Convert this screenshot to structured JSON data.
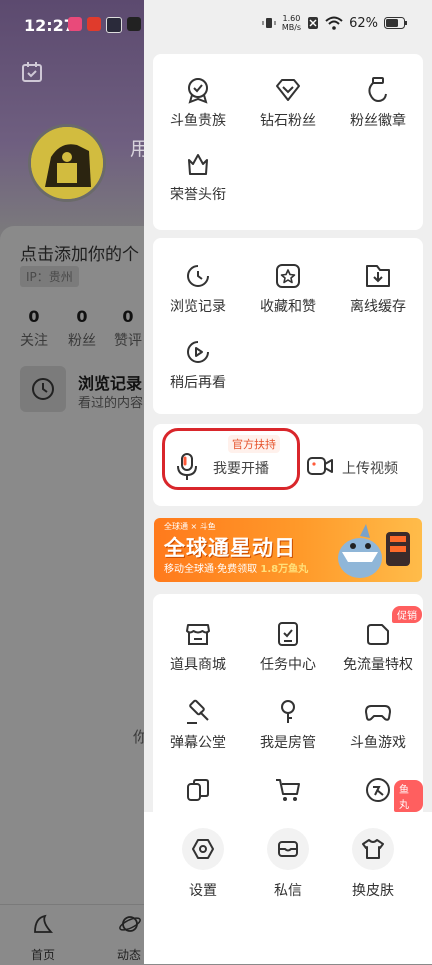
{
  "status_bar": {
    "time": "12:27",
    "net_speed_value": "1.60",
    "net_speed_unit": "MB/s",
    "battery": "62%"
  },
  "background": {
    "username": "用",
    "bio": "点击添加你的个",
    "ip": "IP：贵州",
    "stats": [
      {
        "value": "0",
        "label": "关注"
      },
      {
        "value": "0",
        "label": "粉丝"
      },
      {
        "value": "0",
        "label": "赞评"
      }
    ],
    "history_title": "浏览记录",
    "history_sub": "看过的内容",
    "mid_text": "你",
    "tabs": [
      {
        "label": "首页"
      },
      {
        "label": "动态"
      }
    ]
  },
  "drawer": {
    "card1": [
      {
        "label": "斗鱼贵族",
        "icon": "noble-medal-icon"
      },
      {
        "label": "钻石粉丝",
        "icon": "diamond-icon"
      },
      {
        "label": "粉丝徽章",
        "icon": "fan-badge-icon"
      },
      {
        "label": "荣誉头衔",
        "icon": "crown-icon"
      }
    ],
    "card2": [
      {
        "label": "浏览记录",
        "icon": "history-clock-icon"
      },
      {
        "label": "收藏和赞",
        "icon": "favorite-star-icon"
      },
      {
        "label": "离线缓存",
        "icon": "download-icon"
      },
      {
        "label": "稍后再看",
        "icon": "watch-later-icon"
      }
    ],
    "live": {
      "official_badge": "官方扶持",
      "start_label": "我要开播",
      "upload_label": "上传视频"
    },
    "banner": {
      "top": "全球通 × 斗鱼",
      "title": "全球通星动日",
      "sub_prefix": "移动全球通·免费领取",
      "sub_highlight": "1.8万鱼丸"
    },
    "card3": [
      {
        "label": "道具商城",
        "icon": "shop-icon"
      },
      {
        "label": "任务中心",
        "icon": "task-icon"
      },
      {
        "label": "免流量特权",
        "icon": "free-data-icon",
        "badge": "促销"
      },
      {
        "label": "弹幕公堂",
        "icon": "gavel-icon"
      },
      {
        "label": "我是房管",
        "icon": "key-icon"
      },
      {
        "label": "斗鱼游戏",
        "icon": "gamepad-icon"
      },
      {
        "label": "",
        "icon": "copy-icon"
      },
      {
        "label": "",
        "icon": "cart-icon"
      },
      {
        "label": "",
        "icon": "yuwan-icon",
        "badge": "鱼丸"
      }
    ],
    "bottom": [
      {
        "label": "设置",
        "icon": "settings-icon"
      },
      {
        "label": "私信",
        "icon": "message-icon"
      },
      {
        "label": "换皮肤",
        "icon": "skin-shirt-icon"
      }
    ]
  }
}
